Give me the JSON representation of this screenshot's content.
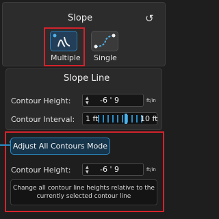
{
  "header": {
    "title": "Slope"
  },
  "modes": [
    {
      "label": "Multiple",
      "icon": "multiple-slope-icon",
      "selected": true
    },
    {
      "label": "Single",
      "icon": "single-slope-icon",
      "selected": false
    }
  ],
  "slope_line": {
    "title": "Slope Line",
    "contour_height": {
      "label": "Contour Height:",
      "value": "-6 ' 9",
      "unit_top": "ft/in",
      "unit_bottom": ""
    },
    "contour_interval": {
      "label": "Contour Interval:",
      "min": "1 ft",
      "max": "10 ft",
      "level_fraction": 0.55
    }
  },
  "adjust": {
    "button_label": "Adjust All Contours Mode",
    "contour_height": {
      "label": "Contour Height:",
      "value": "-6 ' 9",
      "unit_top": "ft/in"
    },
    "tooltip": "Change all contour line heights relative to the currently selected contour line"
  },
  "colors": {
    "accent": "#2a8ec8",
    "highlight": "#d4232c",
    "bg": "#1e1e1e"
  }
}
